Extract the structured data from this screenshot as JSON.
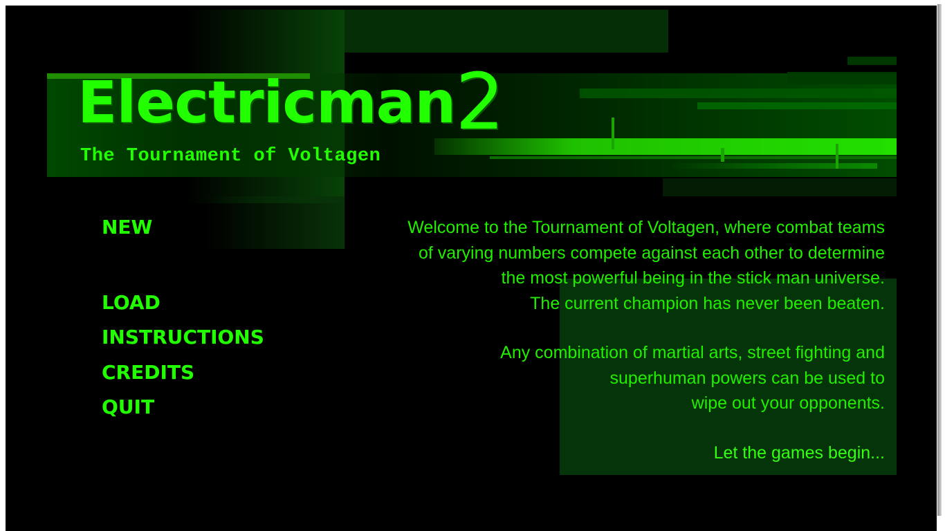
{
  "game": {
    "title_main": "Electricman",
    "title_number": "2",
    "subtitle": "The Tournament of Voltagen"
  },
  "menu": {
    "new": "NEW",
    "load": "LOAD",
    "instructions": "INSTRUCTIONS",
    "credits": "CREDITS",
    "quit": "QUIT"
  },
  "intro": {
    "paragraph1": [
      "Welcome to the Tournament of Voltagen, where combat teams",
      "of varying numbers compete against each other to determine",
      "the most powerful being in the stick man universe.",
      "The current champion has never been beaten."
    ],
    "paragraph2": [
      "Any combination of martial arts, street fighting and",
      "superhuman powers can be used to",
      "wipe out your opponents."
    ],
    "closing": "Let the games begin..."
  },
  "colors": {
    "accent": "#22ff00",
    "background": "#000000",
    "panel": "#053a05"
  }
}
